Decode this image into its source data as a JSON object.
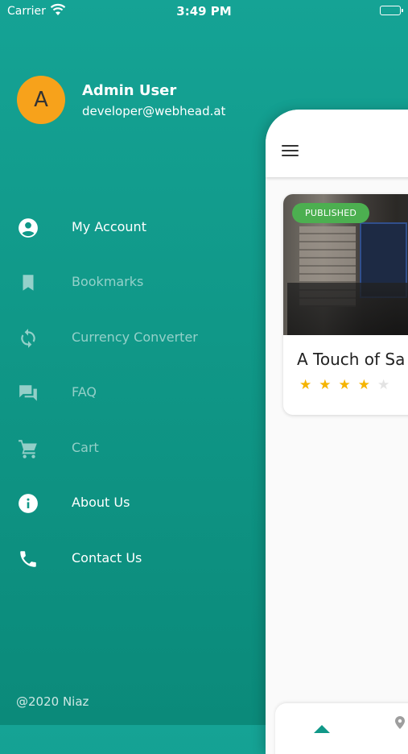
{
  "status_bar": {
    "carrier": "Carrier",
    "time": "3:49 PM"
  },
  "profile": {
    "avatar_initial": "A",
    "name": "Admin User",
    "email": "developer@webhead.at",
    "avatar_color": "#f7a21b"
  },
  "menu": {
    "items": [
      {
        "label": "My Account",
        "icon": "account-circle-icon",
        "enabled": true
      },
      {
        "label": "Bookmarks",
        "icon": "bookmark-icon",
        "enabled": false
      },
      {
        "label": "Currency Converter",
        "icon": "sync-icon",
        "enabled": false
      },
      {
        "label": "FAQ",
        "icon": "forum-icon",
        "enabled": false
      },
      {
        "label": "Cart",
        "icon": "cart-icon",
        "enabled": false
      },
      {
        "label": "About Us",
        "icon": "info-icon",
        "enabled": true
      },
      {
        "label": "Contact Us",
        "icon": "phone-icon",
        "enabled": true
      }
    ]
  },
  "footer": {
    "text": "@2020 Niaz"
  },
  "main": {
    "card": {
      "badge": "PUBLISHED",
      "title": "A Touch of Sa",
      "rating": 4,
      "rating_max": 5,
      "badge_color": "#4caf50",
      "star_color": "#f5b400"
    }
  },
  "colors": {
    "drawer_bg": "#109888",
    "accent": "#f7a21b"
  }
}
